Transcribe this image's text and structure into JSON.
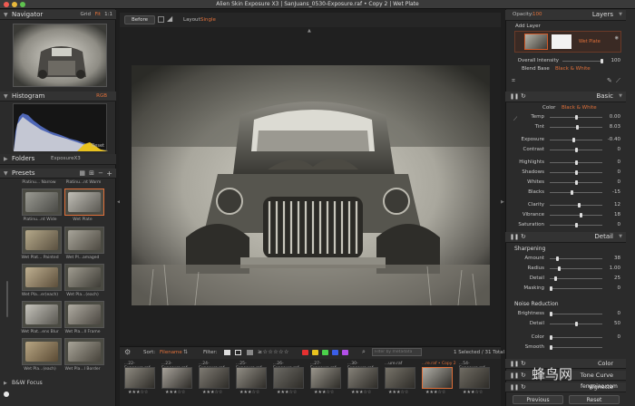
{
  "window": {
    "title": "Alien Skin Exposure X3 | SanJuans_0530-Exposure.raf • Copy 2 | Wet Plate"
  },
  "navigator": {
    "title": "Navigator",
    "zoom_options": [
      "Grid",
      "Fit",
      "1:1"
    ]
  },
  "histogram": {
    "title": "Histogram",
    "mode": "RGB",
    "reset_label": "Reset"
  },
  "folders": {
    "title": "Folders",
    "current": "ExposureX3"
  },
  "presets": {
    "title": "Presets",
    "header_names": [
      "Platinu... Narrow",
      "Platinu...nt Warm"
    ],
    "items": [
      {
        "label": "Platinu...nt Wide"
      },
      {
        "label": "Wet Plate"
      },
      {
        "label": "Wet Plat... Painted"
      },
      {
        "label": "Wet Pl...amaged"
      },
      {
        "label": "Wet Pla...er(each)"
      },
      {
        "label": "Wet Pla...(each)"
      },
      {
        "label": "Wet Plat...ens Blur"
      },
      {
        "label": "Wet Pla...ll Frame"
      },
      {
        "label": "Wet Pla...(each)"
      },
      {
        "label": "Wet Pla...l Border"
      }
    ],
    "footer": "B&W Focus"
  },
  "toolbar": {
    "before_label": "Before",
    "layout_label": "Layout:",
    "layout_value": "Single"
  },
  "filmstrip_bar": {
    "sort_label": "Sort:",
    "sort_value": "Filename",
    "filter_label": "Filter:",
    "search_placeholder": "Filter by metadata",
    "count_text": "1 Selected / 31 Total",
    "color_labels": [
      "#e53030",
      "#e8c21f",
      "#4bd14b",
      "#3a5ee8",
      "#b34fe8"
    ]
  },
  "filmstrip": {
    "items": [
      {
        "label": "...22-Exposure.raf",
        "stars": "★★★☆☆"
      },
      {
        "label": "...23-Exposure.raf",
        "stars": "★★★☆☆"
      },
      {
        "label": "...24-Exposure.raf",
        "stars": "★★★☆☆"
      },
      {
        "label": "...25-Exposure.raf",
        "stars": "★★★☆☆"
      },
      {
        "label": "...26-Exposure.raf",
        "stars": "★★★☆☆"
      },
      {
        "label": "...27-Exposure.raf",
        "stars": "★★★☆☆"
      },
      {
        "label": "...30-Exposure.raf",
        "stars": "★★★☆☆"
      },
      {
        "label": "...ure.raf",
        "stars": "★★★☆☆"
      },
      {
        "label": "...re.raf • Copy 2",
        "stars": "★★★☆☆"
      },
      {
        "label": "...54-Exposure.raf",
        "stars": "★★★☆☆"
      }
    ]
  },
  "layers": {
    "opacity_label": "Opacity:",
    "opacity_value": "100",
    "title": "Layers",
    "add_layer_label": "Add Layer",
    "layer_name": "Wet Plate",
    "overall_intensity_label": "Overall Intensity",
    "overall_intensity_value": "100",
    "blend_base_label": "Blend Base",
    "blend_base_value": "Black & White"
  },
  "basic": {
    "title": "Basic",
    "color_tab": "Color",
    "bw_tab": "Black & White",
    "sliders": [
      {
        "label": "Temp",
        "value": "0.00",
        "pos": 0.5
      },
      {
        "label": "Tint",
        "value": "8.03",
        "pos": 0.52
      },
      {
        "label": "Exposure",
        "value": "-0.40",
        "pos": 0.46
      },
      {
        "label": "Contrast",
        "value": "0",
        "pos": 0.5
      },
      {
        "label": "Highlights",
        "value": "0",
        "pos": 0.5
      },
      {
        "label": "Shadows",
        "value": "0",
        "pos": 0.5
      },
      {
        "label": "Whites",
        "value": "0",
        "pos": 0.5
      },
      {
        "label": "Blacks",
        "value": "-15",
        "pos": 0.42
      },
      {
        "label": "Clarity",
        "value": "12",
        "pos": 0.56
      },
      {
        "label": "Vibrance",
        "value": "18",
        "pos": 0.59
      },
      {
        "label": "Saturation",
        "value": "0",
        "pos": 0.5
      }
    ]
  },
  "detail": {
    "title": "Detail",
    "sharpening_label": "Sharpening",
    "sharpening": [
      {
        "label": "Amount",
        "value": "38",
        "pos": 0.15
      },
      {
        "label": "Radius",
        "value": "1.00",
        "pos": 0.18
      },
      {
        "label": "Detail",
        "value": "25",
        "pos": 0.12
      },
      {
        "label": "Masking",
        "value": "0",
        "pos": 0.02
      }
    ],
    "noise_label": "Noise Reduction",
    "noise": [
      {
        "label": "Brightness",
        "value": "0",
        "pos": 0.02
      },
      {
        "label": "Detail",
        "value": "50",
        "pos": 0.5
      },
      {
        "label": "Color",
        "value": "0",
        "pos": 0.02
      },
      {
        "label": "Smooth",
        "value": "",
        "pos": 0.02
      }
    ]
  },
  "partial_panels": [
    "Color",
    "Tone Curve",
    "Vignette"
  ],
  "buttons": {
    "previous_label": "Previous",
    "reset_label": "Reset"
  },
  "watermark": {
    "text": "蜂鸟网",
    "url": "fengniao.com"
  }
}
